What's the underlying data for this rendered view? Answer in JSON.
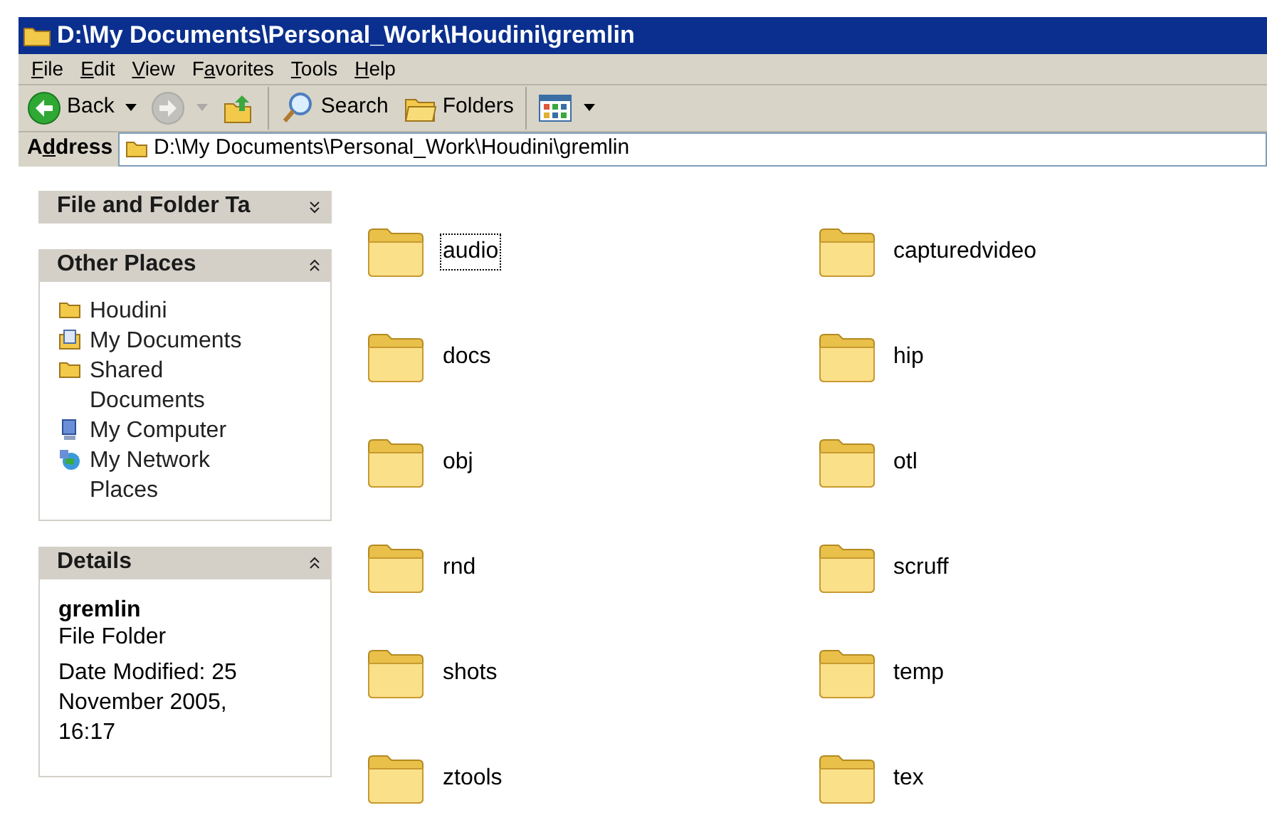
{
  "window": {
    "title": "D:\\My Documents\\Personal_Work\\Houdini\\gremlin"
  },
  "menu": [
    {
      "key": "F",
      "after": "ile"
    },
    {
      "key": "E",
      "after": "dit"
    },
    {
      "key": "V",
      "after": "iew"
    },
    {
      "before": "F",
      "key": "a",
      "after": "vorites"
    },
    {
      "key": "T",
      "after": "ools"
    },
    {
      "key": "H",
      "after": "elp"
    }
  ],
  "toolbar": [
    {
      "kind": "back",
      "label": "Back",
      "disabled": false
    },
    {
      "kind": "forward",
      "disabled": true
    },
    {
      "kind": "up",
      "disabled": false
    },
    {
      "kind": "separator"
    },
    {
      "kind": "search",
      "label": "Search",
      "disabled": false
    },
    {
      "kind": "folders",
      "label": "Folders",
      "disabled": false
    },
    {
      "kind": "separator"
    },
    {
      "kind": "views",
      "disabled": false
    }
  ],
  "address": {
    "label": {
      "before": "A",
      "key": "d",
      "after": "dress"
    },
    "value": "D:\\My Documents\\Personal_Work\\Houdini\\gremlin"
  },
  "task_panes": [
    {
      "title": "File and Folder Ta",
      "expanded": false
    },
    {
      "title": "Other Places",
      "expanded": true,
      "items": [
        {
          "kind": "folder",
          "label": "Houdini"
        },
        {
          "kind": "documents",
          "label": "My Documents"
        },
        {
          "kind": "folder",
          "label": "Shared Documents"
        },
        {
          "kind": "computer",
          "label": "My Computer"
        },
        {
          "kind": "network",
          "label": "My Network Places"
        }
      ]
    },
    {
      "title": "Details",
      "expanded": true,
      "details": {
        "name": "gremlin",
        "type": "File Folder",
        "modified": "Date Modified: 25 November 2005, 16:17"
      }
    }
  ],
  "folders": [
    {
      "label": "audio",
      "focused": true
    },
    {
      "label": "capturedvideo",
      "focused": false
    },
    {
      "label": "docs",
      "focused": false
    },
    {
      "label": "hip",
      "focused": false
    },
    {
      "label": "obj",
      "focused": false
    },
    {
      "label": "otl",
      "focused": false
    },
    {
      "label": "rnd",
      "focused": false
    },
    {
      "label": "scruff",
      "focused": false
    },
    {
      "label": "shots",
      "focused": false
    },
    {
      "label": "temp",
      "focused": false
    },
    {
      "label": "ztools",
      "focused": false
    },
    {
      "label": "tex",
      "focused": false
    }
  ]
}
